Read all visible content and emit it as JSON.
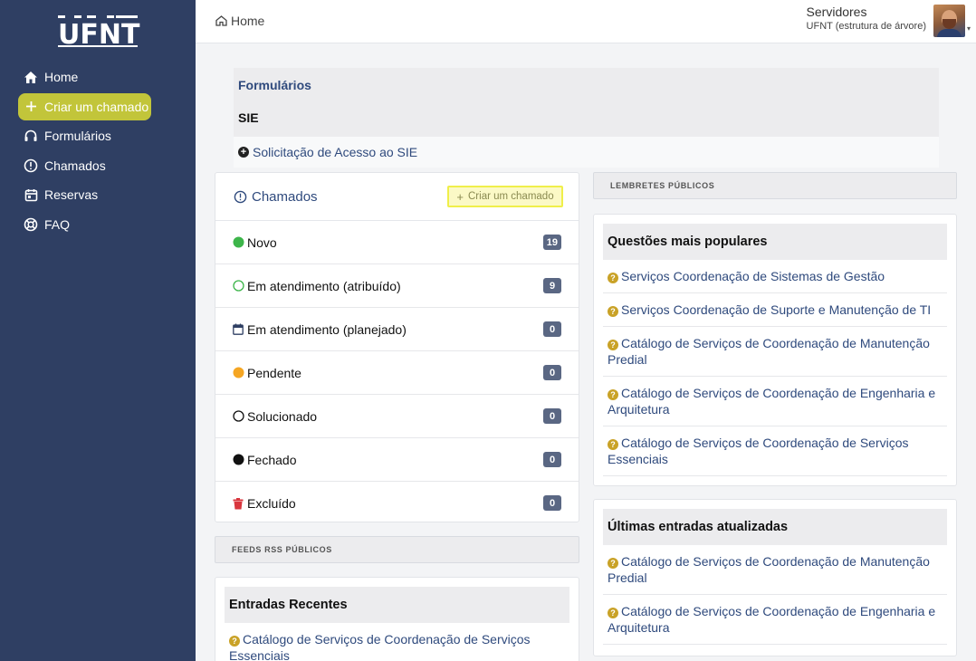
{
  "logo": {
    "text": "UFNT"
  },
  "sidebar": {
    "items": [
      {
        "label": "Home",
        "icon": "home-icon"
      },
      {
        "label": "Criar um chamado",
        "icon": "plus-icon"
      },
      {
        "label": "Formulários",
        "icon": "headset-icon"
      },
      {
        "label": "Chamados",
        "icon": "alert-circle-icon"
      },
      {
        "label": "Reservas",
        "icon": "calendar-icon"
      },
      {
        "label": "FAQ",
        "icon": "lifebuoy-icon"
      }
    ],
    "active_color": "#c2c53a",
    "bg_color": "#2f3f63"
  },
  "header": {
    "breadcrumb": "Home",
    "user_name": "Servidores",
    "user_entity": "UFNT (estrutura de árvore)"
  },
  "forms": {
    "title": "Formulários",
    "category": "SIE",
    "link": "Solicitação de Acesso ao SIE"
  },
  "tickets": {
    "title": "Chamados",
    "create_label": "Criar um chamado",
    "rows": [
      {
        "label": "Novo",
        "count": "19",
        "status_color": "#3db54a"
      },
      {
        "label": "Em atendimento (atribuído)",
        "count": "9",
        "status_color": "#3db54a"
      },
      {
        "label": "Em atendimento (planejado)",
        "count": "0",
        "status_color": "#2f3f63"
      },
      {
        "label": "Pendente",
        "count": "0",
        "status_color": "#f5a623"
      },
      {
        "label": "Solucionado",
        "count": "0",
        "status_color": "#111111"
      },
      {
        "label": "Fechado",
        "count": "0",
        "status_color": "#111111"
      },
      {
        "label": "Excluído",
        "count": "0",
        "status_color": "#d9363e"
      }
    ]
  },
  "rss": {
    "heading": "FEEDS RSS PÚBLICOS"
  },
  "reminders": {
    "heading": "LEMBRETES PÚBLICOS"
  },
  "recent": {
    "title": "Entradas Recentes",
    "items": [
      "Catálogo de Serviços de Coordenação de Serviços Essenciais"
    ]
  },
  "popular": {
    "title": "Questões mais populares",
    "items": [
      "Serviços Coordenação de Sistemas de Gestão",
      "Serviços Coordenação de Suporte e Manutenção de TI",
      "Catálogo de Serviços de Coordenação de Manutenção Predial",
      "Catálogo de Serviços de Coordenação de Engenharia e Arquitetura",
      "Catálogo de Serviços de Coordenação de Serviços Essenciais"
    ]
  },
  "last_updated": {
    "title": "Últimas entradas atualizadas",
    "items": [
      "Catálogo de Serviços de Coordenação de Manutenção Predial",
      "Catálogo de Serviços de Coordenação de Engenharia e Arquitetura"
    ]
  }
}
